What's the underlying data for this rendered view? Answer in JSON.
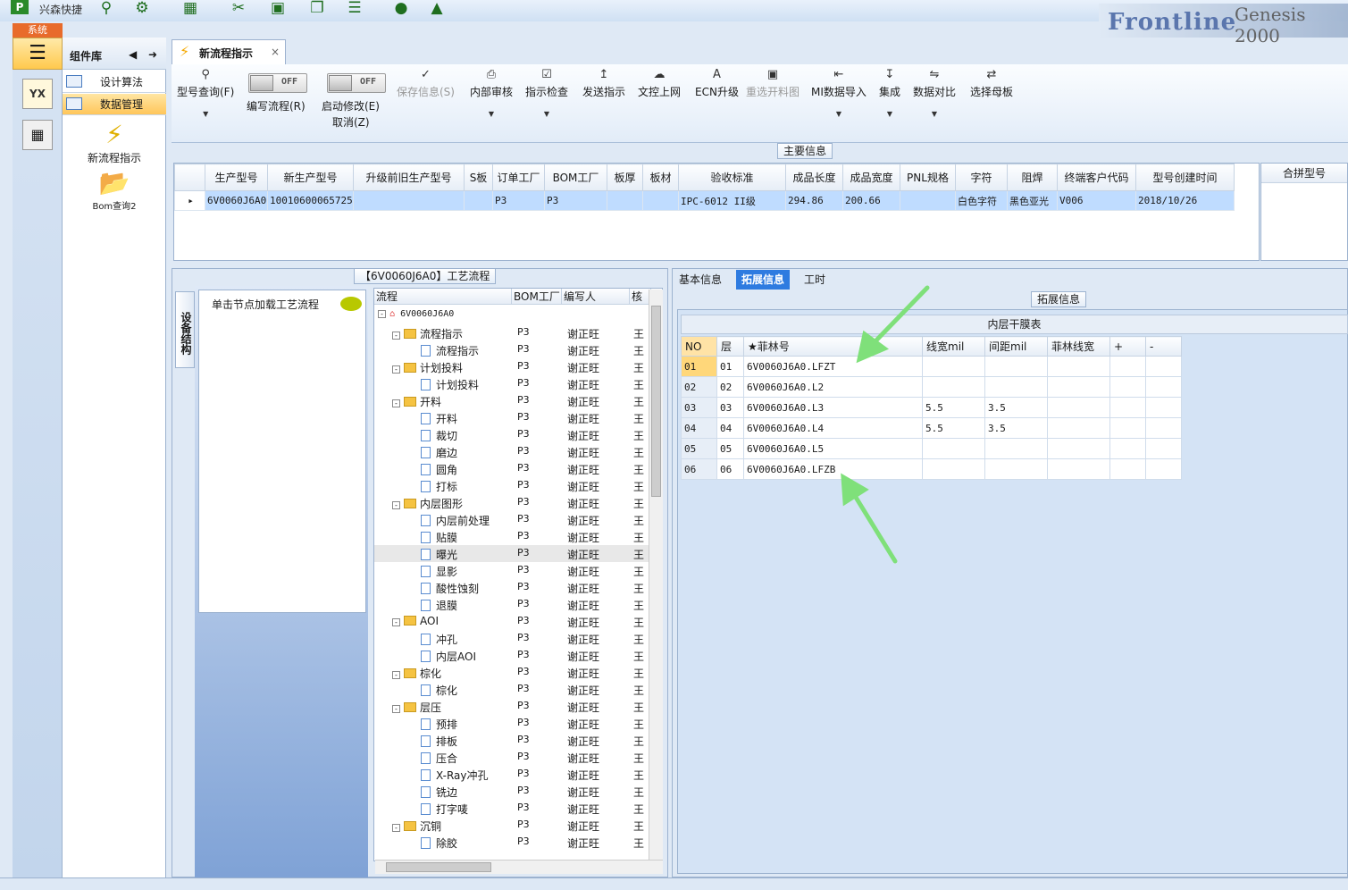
{
  "app": {
    "name": "兴森快捷",
    "system_btn": "系统",
    "brand_main": "Frontline",
    "brand_sub": "Genesis 2000"
  },
  "quick_toolbar": [
    "search-icon",
    "settings-icon",
    "grid-icon",
    "scissors-icon",
    "save-icon",
    "copy-icon",
    "list-icon",
    "user-icon",
    "chart-icon"
  ],
  "nav": {
    "header": "组件库",
    "items": [
      {
        "label": "设计算法"
      },
      {
        "label": "数据管理"
      }
    ],
    "tools": [
      {
        "label": "新流程指示",
        "icon": "lightning-icon"
      },
      {
        "label": "Bom查询2",
        "icon": "folder-icon"
      }
    ]
  },
  "left_icons": {
    "yx": "YX"
  },
  "doc_tab": {
    "label": "新流程指示",
    "close": "×"
  },
  "ribbon": {
    "btn_model_query": "型号查询(F)",
    "btn_write_flow": "编写流程(R)",
    "btn_start_modify": "启动修改(E)",
    "btn_cancel": "取消(Z)",
    "toggle_off": "OFF",
    "btn_save_info": "保存信息(S)",
    "btn_internal_review": "内部审核",
    "btn_instruction_check": "指示检查",
    "btn_send_instruction": "发送指示",
    "btn_doc_upload": "文控上网",
    "btn_ecn_upgrade": "ECN升级",
    "btn_reselect_drawing": "重选开料图",
    "btn_mi_import": "MI数据导入",
    "btn_integrate": "集成",
    "btn_data_compare": "数据对比",
    "btn_select_mother": "选择母板"
  },
  "main_info": {
    "title": "主要信息",
    "columns": [
      "生产型号",
      "新生产型号",
      "升级前旧生产型号",
      "S板",
      "订单工厂",
      "BOM工厂",
      "板厚",
      "板材",
      "验收标准",
      "成品长度",
      "成品宽度",
      "PNL规格",
      "字符",
      "阻焊",
      "终端客户代码",
      "型号创建时间"
    ],
    "row": [
      "6V0060J6A0",
      "10010600065725",
      "",
      "",
      "P3",
      "P3",
      "",
      "",
      "IPC-6012 II级",
      "294.86",
      "200.66",
      "",
      "白色字符",
      "黑色亚光",
      "V006",
      "2018/10/26"
    ],
    "merge_header": "合拼型号"
  },
  "flow": {
    "title": "【6V0060J6A0】工艺流程",
    "side_tab": "设备结构",
    "hint": "单击节点加载工艺流程",
    "columns": [
      "流程",
      "BOM工厂",
      "编写人",
      "核"
    ],
    "root": "6V0060J6A0",
    "rows": [
      {
        "name": "流程指示",
        "type": "folder",
        "bom": "P3",
        "writer": "谢正旺",
        "rev": "王"
      },
      {
        "name": "流程指示",
        "type": "doc",
        "bom": "P3",
        "writer": "谢正旺",
        "rev": "王"
      },
      {
        "name": "计划投料",
        "type": "folder",
        "bom": "P3",
        "writer": "谢正旺",
        "rev": "王"
      },
      {
        "name": "计划投料",
        "type": "doc",
        "bom": "P3",
        "writer": "谢正旺",
        "rev": "王"
      },
      {
        "name": "开料",
        "type": "folder",
        "bom": "P3",
        "writer": "谢正旺",
        "rev": "王"
      },
      {
        "name": "开料",
        "type": "doc",
        "bom": "P3",
        "writer": "谢正旺",
        "rev": "王"
      },
      {
        "name": "裁切",
        "type": "doc",
        "bom": "P3",
        "writer": "谢正旺",
        "rev": "王"
      },
      {
        "name": "磨边",
        "type": "doc",
        "bom": "P3",
        "writer": "谢正旺",
        "rev": "王"
      },
      {
        "name": "圆角",
        "type": "doc",
        "bom": "P3",
        "writer": "谢正旺",
        "rev": "王"
      },
      {
        "name": "打标",
        "type": "doc",
        "bom": "P3",
        "writer": "谢正旺",
        "rev": "王"
      },
      {
        "name": "内层图形",
        "type": "folder",
        "bom": "P3",
        "writer": "谢正旺",
        "rev": "王"
      },
      {
        "name": "内层前处理",
        "type": "doc",
        "bom": "P3",
        "writer": "谢正旺",
        "rev": "王"
      },
      {
        "name": "贴膜",
        "type": "doc",
        "bom": "P3",
        "writer": "谢正旺",
        "rev": "王"
      },
      {
        "name": "曝光",
        "type": "doc",
        "bom": "P3",
        "writer": "谢正旺",
        "rev": "王",
        "selected": true
      },
      {
        "name": "显影",
        "type": "doc",
        "bom": "P3",
        "writer": "谢正旺",
        "rev": "王"
      },
      {
        "name": "酸性蚀刻",
        "type": "doc",
        "bom": "P3",
        "writer": "谢正旺",
        "rev": "王"
      },
      {
        "name": "退膜",
        "type": "doc",
        "bom": "P3",
        "writer": "谢正旺",
        "rev": "王"
      },
      {
        "name": "AOI",
        "type": "folder",
        "bom": "P3",
        "writer": "谢正旺",
        "rev": "王"
      },
      {
        "name": "冲孔",
        "type": "doc",
        "bom": "P3",
        "writer": "谢正旺",
        "rev": "王"
      },
      {
        "name": "内层AOI",
        "type": "doc",
        "bom": "P3",
        "writer": "谢正旺",
        "rev": "王"
      },
      {
        "name": "棕化",
        "type": "folder",
        "bom": "P3",
        "writer": "谢正旺",
        "rev": "王"
      },
      {
        "name": "棕化",
        "type": "doc",
        "bom": "P3",
        "writer": "谢正旺",
        "rev": "王"
      },
      {
        "name": "层压",
        "type": "folder",
        "bom": "P3",
        "writer": "谢正旺",
        "rev": "王"
      },
      {
        "name": "预排",
        "type": "doc",
        "bom": "P3",
        "writer": "谢正旺",
        "rev": "王"
      },
      {
        "name": "排板",
        "type": "doc",
        "bom": "P3",
        "writer": "谢正旺",
        "rev": "王"
      },
      {
        "name": "压合",
        "type": "doc",
        "bom": "P3",
        "writer": "谢正旺",
        "rev": "王"
      },
      {
        "name": "X-Ray冲孔",
        "type": "doc",
        "bom": "P3",
        "writer": "谢正旺",
        "rev": "王"
      },
      {
        "name": "铣边",
        "type": "doc",
        "bom": "P3",
        "writer": "谢正旺",
        "rev": "王"
      },
      {
        "name": "打字唛",
        "type": "doc",
        "bom": "P3",
        "writer": "谢正旺",
        "rev": "王"
      },
      {
        "name": "沉铜",
        "type": "folder",
        "bom": "P3",
        "writer": "谢正旺",
        "rev": "王"
      },
      {
        "name": "除胶",
        "type": "doc",
        "bom": "P3",
        "writer": "谢正旺",
        "rev": "王"
      }
    ]
  },
  "right": {
    "tabs": [
      "基本信息",
      "拓展信息",
      "工时"
    ],
    "section_title": "拓展信息",
    "table_title": "内层干膜表",
    "columns": [
      "NO",
      "层",
      "★菲林号",
      "线宽mil",
      "间距mil",
      "菲林线宽",
      "+",
      "-"
    ],
    "rows": [
      [
        "01",
        "01",
        "6V0060J6A0.LFZT",
        "",
        "",
        "",
        "",
        ""
      ],
      [
        "02",
        "02",
        "6V0060J6A0.L2",
        "",
        "",
        "",
        "",
        ""
      ],
      [
        "03",
        "03",
        "6V0060J6A0.L3",
        "5.5",
        "3.5",
        "",
        "",
        ""
      ],
      [
        "04",
        "04",
        "6V0060J6A0.L4",
        "5.5",
        "3.5",
        "",
        "",
        ""
      ],
      [
        "05",
        "05",
        "6V0060J6A0.L5",
        "",
        "",
        "",
        "",
        ""
      ],
      [
        "06",
        "06",
        "6V0060J6A0.LFZB",
        "",
        "",
        "",
        "",
        ""
      ]
    ]
  }
}
